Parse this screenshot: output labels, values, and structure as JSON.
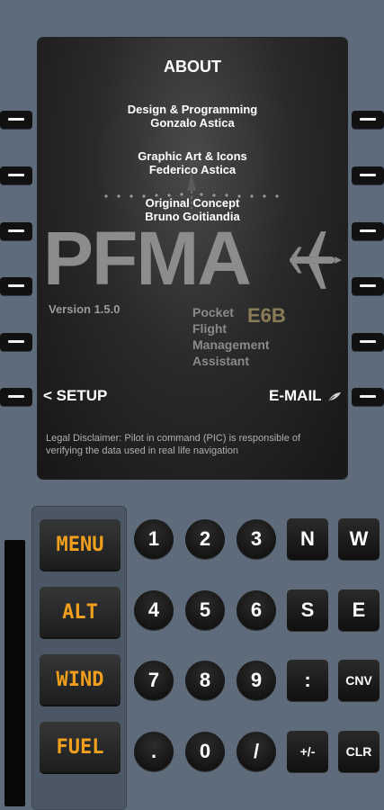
{
  "screen": {
    "title": "ABOUT",
    "credits": [
      {
        "role": "Design & Programming",
        "name": "Gonzalo Astica"
      },
      {
        "role": "Graphic Art & Icons",
        "name": "Federico Astica"
      },
      {
        "role": "Original Concept",
        "name": "Bruno Goitiandia"
      }
    ],
    "logo": "PFMA",
    "version": "Version 1.5.0",
    "tagline": [
      "Pocket",
      "Flight",
      "Management",
      "Assistant"
    ],
    "e6b": "E6B",
    "setup_label": "< SETUP",
    "email_label": "E-MAIL",
    "disclaimer": "Legal Disclaimer: Pilot in command (PIC) is responsible of verifying the data used in real life navigation"
  },
  "function_keys": [
    "MENU",
    "ALT",
    "WIND",
    "FUEL"
  ],
  "keypad": {
    "row1": [
      "1",
      "2",
      "3",
      "N",
      "W"
    ],
    "row2": [
      "4",
      "5",
      "6",
      "S",
      "E"
    ],
    "row3": [
      "7",
      "8",
      "9",
      ":",
      "CNV"
    ],
    "row4": [
      ".",
      "0",
      "/",
      "+/-",
      "CLR"
    ]
  },
  "colors": {
    "accent": "#f19f1c",
    "background": "#5d6b7b",
    "screen": "#1e1e1e"
  }
}
